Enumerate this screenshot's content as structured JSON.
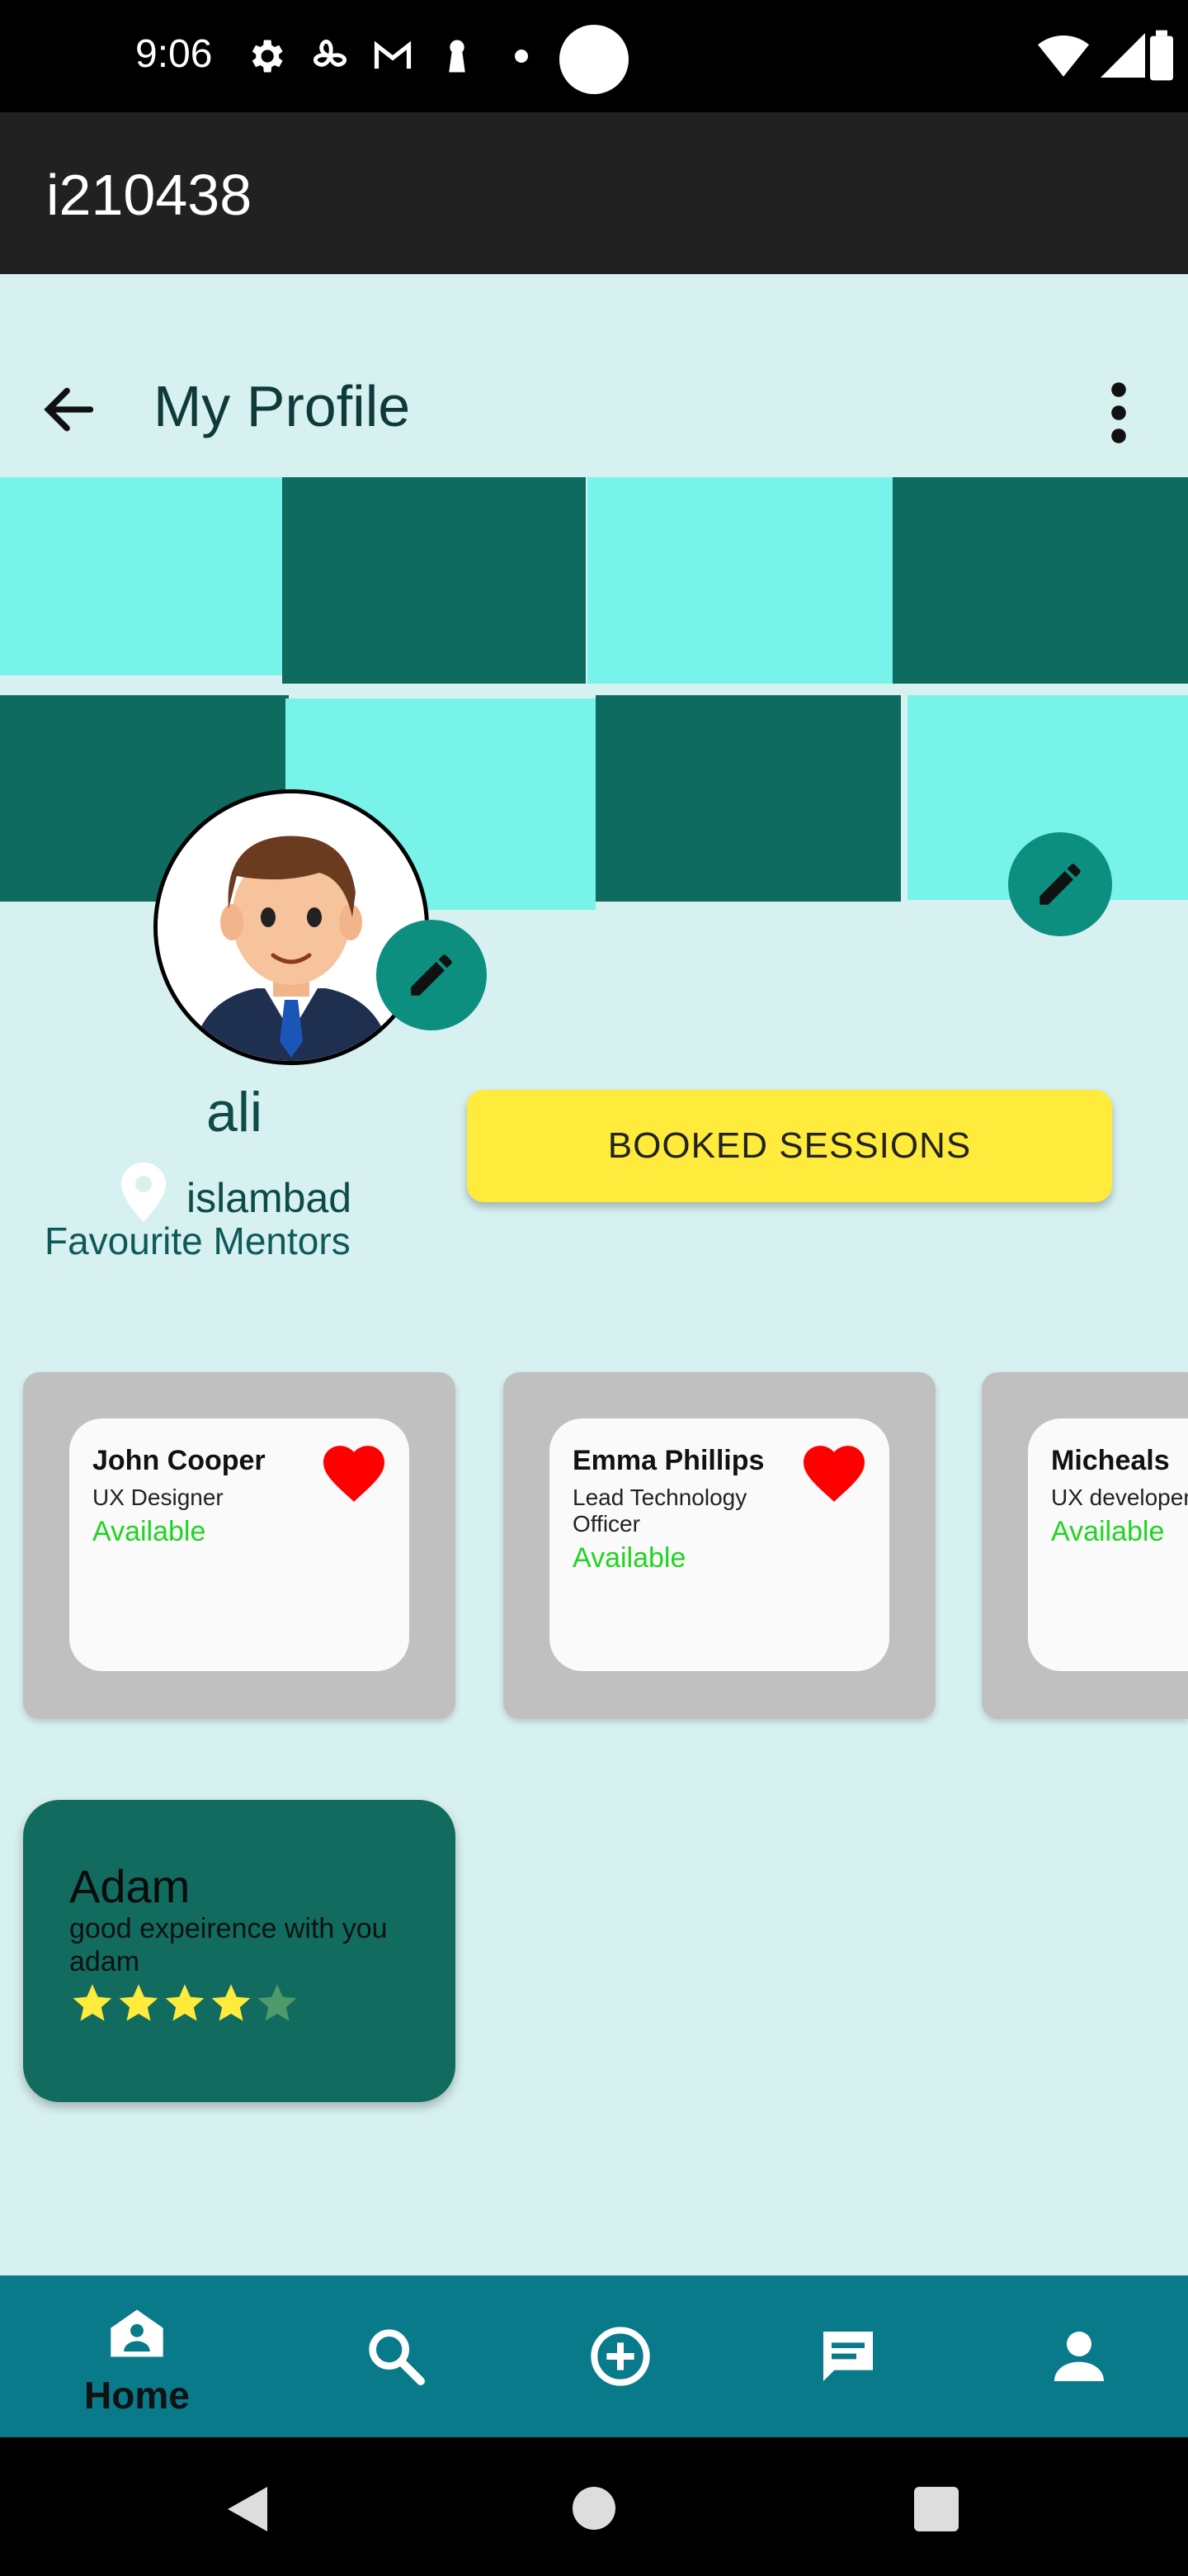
{
  "status_bar": {
    "time": "9:06"
  },
  "app_bar": {
    "title": "i210438"
  },
  "toolbar": {
    "title": "My Profile",
    "back_icon": "arrow-back-icon",
    "more_icon": "more-vert-icon"
  },
  "profile": {
    "name": "ali",
    "location": "islambad",
    "favourites_title": "Favourite Mentors",
    "booked_sessions_label": "BOOKED SESSIONS"
  },
  "colors": {
    "background": "#d7f0f0",
    "cover_light": "#77f3ea",
    "cover_dark": "#0f6a60",
    "fab": "#0d8f80",
    "button_yellow": "#ffeb3b",
    "available_green": "#22d322",
    "heart_red": "#ff0000",
    "nav_bar": "#087a8a"
  },
  "mentors": [
    {
      "name": "John Cooper",
      "role": "UX Designer",
      "status": "Available",
      "favourite": true
    },
    {
      "name": "Emma Phillips",
      "role": "Lead Technology Officer",
      "status": "Available",
      "favourite": true
    },
    {
      "name": "Micheals",
      "role": "UX developer",
      "status": "Available",
      "favourite": false
    }
  ],
  "reviews": [
    {
      "name": "Adam",
      "text": "good expeirence with you adam",
      "rating": 4,
      "max_rating": 5
    }
  ],
  "bottom_nav": {
    "items": [
      {
        "icon": "home-icon",
        "label": "Home",
        "active": true
      },
      {
        "icon": "search-icon"
      },
      {
        "icon": "add-circle-icon"
      },
      {
        "icon": "chat-icon"
      },
      {
        "icon": "person-icon"
      }
    ]
  }
}
